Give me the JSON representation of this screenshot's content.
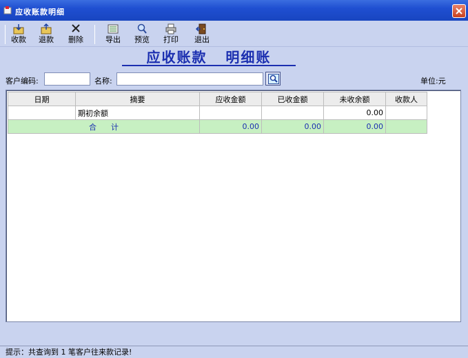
{
  "window": {
    "title": "应收账款明细"
  },
  "toolbar": {
    "receive": "收款",
    "refund": "退款",
    "delete": "删除",
    "export": "导出",
    "preview": "预览",
    "print": "打印",
    "exit": "退出"
  },
  "heading": "应收账款   明细账",
  "search": {
    "customer_code_label": "客户编码:",
    "customer_code_value": "",
    "name_label": "名称:",
    "name_value": "",
    "unit_label": "单位:元"
  },
  "table": {
    "columns": [
      "日期",
      "摘要",
      "应收金额",
      "已收金额",
      "未收余额",
      "收款人"
    ],
    "rows": [
      [
        "",
        "期初余额",
        "",
        "",
        "0.00",
        ""
      ]
    ],
    "total": {
      "label": "合      计",
      "receivable": "0.00",
      "received": "0.00",
      "balance": "0.00",
      "payee": ""
    }
  },
  "status": {
    "message": "提示：共查询到 1 笔客户往来款记录!"
  },
  "colors": {
    "titlebar": "#1f4fd1",
    "heading": "#1b2fb0",
    "total_row": "#c7f0c2",
    "window_bg": "#c9d3ef"
  }
}
